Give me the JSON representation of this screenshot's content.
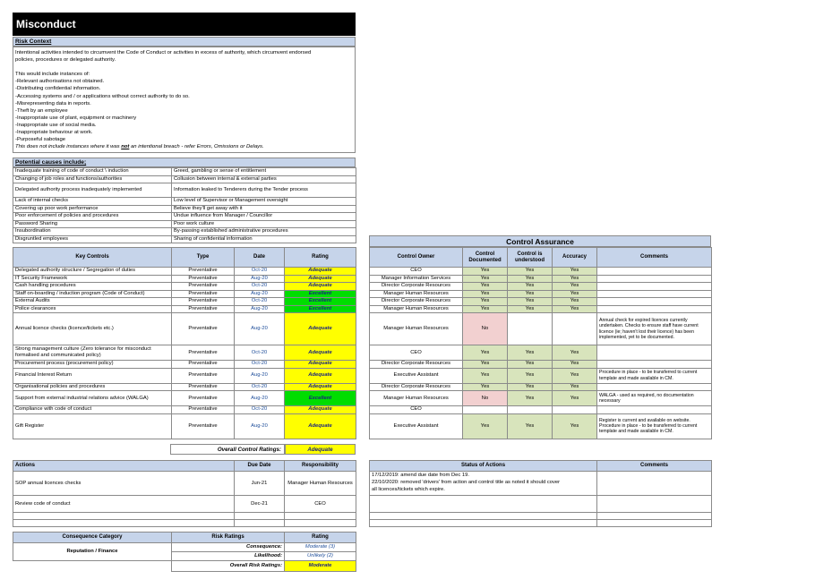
{
  "title": "Misconduct",
  "risk_context": {
    "heading": "Risk Context",
    "lines": [
      "Intentional activities intended to circumvent the Code of Conduct or activities in excess of authority, which circumvent endorsed",
      "policies, procedures or delegated authority.",
      "",
      "This would include instances of:",
      "-Relevant authorisations not obtained.",
      "-Distributing confidential information.",
      "-Accessing systems and / or applications without correct authority to do so.",
      "-Misrepresenting data in reports.",
      "-Theft by an employee",
      "-Inappropriate use of plant, equipment or machinery",
      "-Inappropriate use of social media.",
      "-Inappropriate behaviour at work.",
      "-Purposeful sabotage"
    ],
    "final_pre": "This does not include instances where it was ",
    "final_not": "not",
    "final_post": " an intentional breach - refer Errors, Omissions or Delays."
  },
  "causes": {
    "heading": "Potential causes include;",
    "rows": [
      [
        "Inadequate training of code of conduct \\ induction",
        "Greed, gambling or sense of entitlement"
      ],
      [
        "Changing of job roles and functions/authorities",
        "Collusion between internal & external parties"
      ],
      [
        "Delegated authority process inadequately implemented",
        "Information leaked to Tenderers during the Tender process"
      ],
      [
        "Lack of internal checks",
        "Low level of Supervisor or Management oversight"
      ],
      [
        "Covering up poor work performance",
        "Believe they'll get away with it"
      ],
      [
        "Poor enforcement of policies and procedures",
        "Undue influence from Manager / Councillor"
      ],
      [
        "Password Sharing",
        "Poor work culture"
      ],
      [
        "Insubordination",
        "By-passing established administrative procedures"
      ],
      [
        "Disgruntled employees",
        "Sharing of confidential information"
      ]
    ]
  },
  "controls": {
    "headers": [
      "Key Controls",
      "Type",
      "Date",
      "Rating"
    ],
    "rows": [
      {
        "control": "Delegated authority structure / Segregation of duties",
        "type": "Preventative",
        "date": "Oct-20",
        "rating": "Adequate"
      },
      {
        "control": "IT Security Framework",
        "type": "Preventative",
        "date": "Aug-20",
        "rating": "Adequate"
      },
      {
        "control": "Cash handling procedures",
        "type": "Preventative",
        "date": "Oct-20",
        "rating": "Adequate"
      },
      {
        "control": "Staff on-boarding / induction program (Code of Conduct)",
        "type": "Preventative",
        "date": "Aug-20",
        "rating": "Excellent"
      },
      {
        "control": "External Audits",
        "type": "Preventative",
        "date": "Oct-20",
        "rating": "Excellent"
      },
      {
        "control": "Police clearances",
        "type": "Preventative",
        "date": "Aug-20",
        "rating": "Excellent"
      },
      {
        "control": "Annual licence checks (licence/tickets etc.)",
        "type": "Preventative",
        "date": "Aug-20",
        "rating": "Adequate"
      },
      {
        "control": "Strong management culture (Zero tolerance for misconduct formalised and communicated policy)",
        "type": "Preventative",
        "date": "Oct-20",
        "rating": "Adequate"
      },
      {
        "control": "Procurement process  (procurement policy)",
        "type": "Preventative",
        "date": "Oct-20",
        "rating": "Adequate"
      },
      {
        "control": "Financial Interest Return",
        "type": "Preventative",
        "date": "Aug-20",
        "rating": "Adequate"
      },
      {
        "control": "Organisational policies and procedures",
        "type": "Preventative",
        "date": "Oct-20",
        "rating": "Adequate"
      },
      {
        "control": "Support from external industrial relations advice (WALGA)",
        "type": "Preventative",
        "date": "Aug-20",
        "rating": "Excellent"
      },
      {
        "control": "Compliance with code of conduct",
        "type": "Preventative",
        "date": "Oct-20",
        "rating": "Adequate"
      },
      {
        "control": "Gift Register",
        "type": "Preventative",
        "date": "Aug-20",
        "rating": "Adequate"
      }
    ],
    "overall_label": "Overall Control Ratings:",
    "overall_value": "Adequate"
  },
  "assurance": {
    "heading": "Control Assurance",
    "headers": [
      "Control Owner",
      "Control Documented",
      "Control is understood",
      "Accuracy",
      "Comments"
    ],
    "rows": [
      {
        "owner": "CEO",
        "documented": "Yes",
        "understood": "Yes",
        "accuracy": "Yes",
        "comments": ""
      },
      {
        "owner": "Manager Information Services",
        "documented": "Yes",
        "understood": "Yes",
        "accuracy": "Yes",
        "comments": ""
      },
      {
        "owner": "Director Corporate Resources",
        "documented": "Yes",
        "understood": "Yes",
        "accuracy": "Yes",
        "comments": ""
      },
      {
        "owner": "Manager Human Resources",
        "documented": "Yes",
        "understood": "Yes",
        "accuracy": "Yes",
        "comments": ""
      },
      {
        "owner": "Director Corporate Resources",
        "documented": "Yes",
        "understood": "Yes",
        "accuracy": "Yes",
        "comments": ""
      },
      {
        "owner": "Manager Human Resources",
        "documented": "Yes",
        "understood": "Yes",
        "accuracy": "Yes",
        "comments": ""
      },
      {
        "owner": "Manager Human Resources",
        "documented": "No",
        "understood": "",
        "accuracy": "",
        "comments": "Annual check for expired licences currently undertaken. Checks to ensure staff have current licence (ie; haven't lost their licence) has been implemented, yet to be documented."
      },
      {
        "owner": "CEO",
        "documented": "Yes",
        "understood": "Yes",
        "accuracy": "Yes",
        "comments": ""
      },
      {
        "owner": "Director Corporate Resources",
        "documented": "Yes",
        "understood": "Yes",
        "accuracy": "Yes",
        "comments": ""
      },
      {
        "owner": "Executive Assistant",
        "documented": "Yes",
        "understood": "Yes",
        "accuracy": "Yes",
        "comments": "Procedure in place - to be transferred to current template and made available in CM."
      },
      {
        "owner": "Director Corporate Resources",
        "documented": "Yes",
        "understood": "Yes",
        "accuracy": "Yes",
        "comments": ""
      },
      {
        "owner": "Manager Human Resources",
        "documented": "No",
        "understood": "Yes",
        "accuracy": "Yes",
        "comments": "WALGA - used as required, no documentation necessary"
      },
      {
        "owner": "CEO",
        "documented": "",
        "understood": "",
        "accuracy": "",
        "comments": ""
      },
      {
        "owner": "Executive Assistant",
        "documented": "Yes",
        "understood": "Yes",
        "accuracy": "Yes",
        "comments": "Register is current and available on website. Procedure in place - to be transferred to current template and made available in CM."
      }
    ]
  },
  "actions": {
    "headers": [
      "Actions",
      "Due Date",
      "Responsibility"
    ],
    "rows": [
      {
        "action": "SOP annual licences checks",
        "due": "Jun-21",
        "resp": "Manager Human Resources"
      },
      {
        "action": "Review code of conduct",
        "due": "Dec-21",
        "resp": "CEO"
      }
    ]
  },
  "status": {
    "headers": [
      "Status of Actions",
      "Comments"
    ],
    "lines": [
      "17/12/2019: amend due date from Dec 19.",
      "22/10/2020: removed 'drivers' from action and control title as noted it should cover",
      "all licences/tickets which expire."
    ]
  },
  "consequence": {
    "headers": [
      "Consequence Category",
      "Risk Ratings",
      "Rating"
    ],
    "category": "Reputation / Finance",
    "consequence_label": "Consequence:",
    "consequence_value": "Moderate (3)",
    "likelihood_label": "Likelihood:",
    "likelihood_value": "Unlikely (2)",
    "overall_label": "Overall Risk Ratings:",
    "overall_value": "Moderate"
  },
  "colors": {
    "header_bg": "#c6d4ea",
    "adequate": "#ffff00",
    "excellent": "#00dd00",
    "yes": "#d8e4bc",
    "no": "#f2d0d0"
  }
}
